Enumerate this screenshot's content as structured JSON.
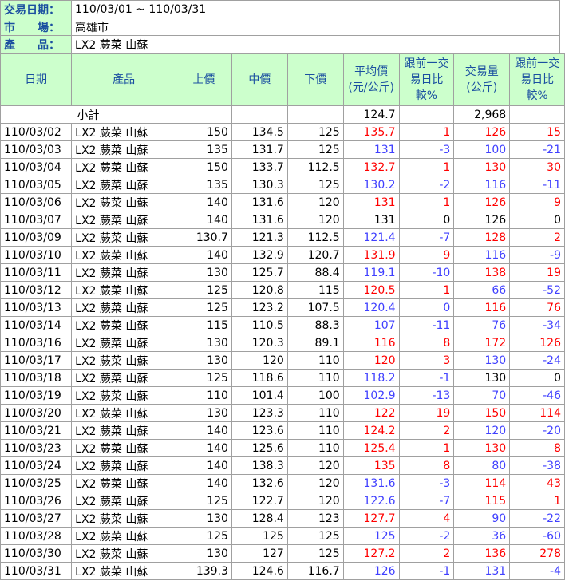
{
  "info": [
    {
      "label": "交易日期：",
      "value": "110/03/01 ~ 110/03/31"
    },
    {
      "label": "市　　場：",
      "value": "高雄市"
    },
    {
      "label": "產　　品：",
      "value": "LX2 蕨菜 山蘇"
    }
  ],
  "headers": [
    "日期",
    "產品",
    "上價",
    "中價",
    "下價",
    "平均價(元/公斤)",
    "跟前一交易日比較%",
    "交易量(公斤)",
    "跟前一交易日比較%"
  ],
  "subtotal": {
    "label": "小計",
    "avg": "124.7",
    "volume": "2,968"
  },
  "colors": {
    "up": "#ff0000",
    "down": "#4040ff",
    "flat": "#000000",
    "header_bg": "#ccffcc",
    "header_text": "#1a4fa0"
  },
  "rows": [
    {
      "date": "110/03/02",
      "product": "LX2 蕨菜 山蘇",
      "high": "150",
      "mid": "134.5",
      "low": "125",
      "avg": "135.7",
      "avg_pct": "1",
      "vol": "126",
      "vol_pct": "15",
      "avg_dir": "up",
      "vol_dir": "up"
    },
    {
      "date": "110/03/03",
      "product": "LX2 蕨菜 山蘇",
      "high": "135",
      "mid": "131.7",
      "low": "125",
      "avg": "131",
      "avg_pct": "-3",
      "vol": "100",
      "vol_pct": "-21",
      "avg_dir": "down",
      "vol_dir": "down"
    },
    {
      "date": "110/03/04",
      "product": "LX2 蕨菜 山蘇",
      "high": "150",
      "mid": "133.7",
      "low": "112.5",
      "avg": "132.7",
      "avg_pct": "1",
      "vol": "130",
      "vol_pct": "30",
      "avg_dir": "up",
      "vol_dir": "up"
    },
    {
      "date": "110/03/05",
      "product": "LX2 蕨菜 山蘇",
      "high": "135",
      "mid": "130.3",
      "low": "125",
      "avg": "130.2",
      "avg_pct": "-2",
      "vol": "116",
      "vol_pct": "-11",
      "avg_dir": "down",
      "vol_dir": "down"
    },
    {
      "date": "110/03/06",
      "product": "LX2 蕨菜 山蘇",
      "high": "140",
      "mid": "131.6",
      "low": "120",
      "avg": "131",
      "avg_pct": "1",
      "vol": "126",
      "vol_pct": "9",
      "avg_dir": "up",
      "vol_dir": "up"
    },
    {
      "date": "110/03/07",
      "product": "LX2 蕨菜 山蘇",
      "high": "140",
      "mid": "131.6",
      "low": "120",
      "avg": "131",
      "avg_pct": "0",
      "vol": "126",
      "vol_pct": "0",
      "avg_dir": "flat",
      "vol_dir": "flat"
    },
    {
      "date": "110/03/09",
      "product": "LX2 蕨菜 山蘇",
      "high": "130.7",
      "mid": "121.3",
      "low": "112.5",
      "avg": "121.4",
      "avg_pct": "-7",
      "vol": "128",
      "vol_pct": "2",
      "avg_dir": "down",
      "vol_dir": "up"
    },
    {
      "date": "110/03/10",
      "product": "LX2 蕨菜 山蘇",
      "high": "140",
      "mid": "132.9",
      "low": "120.7",
      "avg": "131.9",
      "avg_pct": "9",
      "vol": "116",
      "vol_pct": "-9",
      "avg_dir": "up",
      "vol_dir": "down"
    },
    {
      "date": "110/03/11",
      "product": "LX2 蕨菜 山蘇",
      "high": "130",
      "mid": "125.7",
      "low": "88.4",
      "avg": "119.1",
      "avg_pct": "-10",
      "vol": "138",
      "vol_pct": "19",
      "avg_dir": "down",
      "vol_dir": "up"
    },
    {
      "date": "110/03/12",
      "product": "LX2 蕨菜 山蘇",
      "high": "125",
      "mid": "120.8",
      "low": "115",
      "avg": "120.5",
      "avg_pct": "1",
      "vol": "66",
      "vol_pct": "-52",
      "avg_dir": "up",
      "vol_dir": "down"
    },
    {
      "date": "110/03/13",
      "product": "LX2 蕨菜 山蘇",
      "high": "125",
      "mid": "123.2",
      "low": "107.5",
      "avg": "120.4",
      "avg_pct": "0",
      "vol": "116",
      "vol_pct": "76",
      "avg_dir": "down",
      "vol_dir": "up"
    },
    {
      "date": "110/03/14",
      "product": "LX2 蕨菜 山蘇",
      "high": "115",
      "mid": "110.5",
      "low": "88.3",
      "avg": "107",
      "avg_pct": "-11",
      "vol": "76",
      "vol_pct": "-34",
      "avg_dir": "down",
      "vol_dir": "down"
    },
    {
      "date": "110/03/16",
      "product": "LX2 蕨菜 山蘇",
      "high": "130",
      "mid": "120.3",
      "low": "89.1",
      "avg": "116",
      "avg_pct": "8",
      "vol": "172",
      "vol_pct": "126",
      "avg_dir": "up",
      "vol_dir": "up"
    },
    {
      "date": "110/03/17",
      "product": "LX2 蕨菜 山蘇",
      "high": "130",
      "mid": "120",
      "low": "110",
      "avg": "120",
      "avg_pct": "3",
      "vol": "130",
      "vol_pct": "-24",
      "avg_dir": "up",
      "vol_dir": "down"
    },
    {
      "date": "110/03/18",
      "product": "LX2 蕨菜 山蘇",
      "high": "125",
      "mid": "118.6",
      "low": "110",
      "avg": "118.2",
      "avg_pct": "-1",
      "vol": "130",
      "vol_pct": "0",
      "avg_dir": "down",
      "vol_dir": "flat"
    },
    {
      "date": "110/03/19",
      "product": "LX2 蕨菜 山蘇",
      "high": "110",
      "mid": "101.4",
      "low": "100",
      "avg": "102.9",
      "avg_pct": "-13",
      "vol": "70",
      "vol_pct": "-46",
      "avg_dir": "down",
      "vol_dir": "down"
    },
    {
      "date": "110/03/20",
      "product": "LX2 蕨菜 山蘇",
      "high": "130",
      "mid": "123.3",
      "low": "110",
      "avg": "122",
      "avg_pct": "19",
      "vol": "150",
      "vol_pct": "114",
      "avg_dir": "up",
      "vol_dir": "up"
    },
    {
      "date": "110/03/21",
      "product": "LX2 蕨菜 山蘇",
      "high": "140",
      "mid": "123.6",
      "low": "110",
      "avg": "124.2",
      "avg_pct": "2",
      "vol": "120",
      "vol_pct": "-20",
      "avg_dir": "up",
      "vol_dir": "down"
    },
    {
      "date": "110/03/23",
      "product": "LX2 蕨菜 山蘇",
      "high": "140",
      "mid": "125.6",
      "low": "110",
      "avg": "125.4",
      "avg_pct": "1",
      "vol": "130",
      "vol_pct": "8",
      "avg_dir": "up",
      "vol_dir": "up"
    },
    {
      "date": "110/03/24",
      "product": "LX2 蕨菜 山蘇",
      "high": "140",
      "mid": "138.3",
      "low": "120",
      "avg": "135",
      "avg_pct": "8",
      "vol": "80",
      "vol_pct": "-38",
      "avg_dir": "up",
      "vol_dir": "down"
    },
    {
      "date": "110/03/25",
      "product": "LX2 蕨菜 山蘇",
      "high": "140",
      "mid": "132.6",
      "low": "120",
      "avg": "131.6",
      "avg_pct": "-3",
      "vol": "114",
      "vol_pct": "43",
      "avg_dir": "down",
      "vol_dir": "up"
    },
    {
      "date": "110/03/26",
      "product": "LX2 蕨菜 山蘇",
      "high": "125",
      "mid": "122.7",
      "low": "120",
      "avg": "122.6",
      "avg_pct": "-7",
      "vol": "115",
      "vol_pct": "1",
      "avg_dir": "down",
      "vol_dir": "up"
    },
    {
      "date": "110/03/27",
      "product": "LX2 蕨菜 山蘇",
      "high": "130",
      "mid": "128.4",
      "low": "123",
      "avg": "127.7",
      "avg_pct": "4",
      "vol": "90",
      "vol_pct": "-22",
      "avg_dir": "up",
      "vol_dir": "down"
    },
    {
      "date": "110/03/28",
      "product": "LX2 蕨菜 山蘇",
      "high": "125",
      "mid": "125",
      "low": "125",
      "avg": "125",
      "avg_pct": "-2",
      "vol": "36",
      "vol_pct": "-60",
      "avg_dir": "down",
      "vol_dir": "down"
    },
    {
      "date": "110/03/30",
      "product": "LX2 蕨菜 山蘇",
      "high": "130",
      "mid": "127",
      "low": "125",
      "avg": "127.2",
      "avg_pct": "2",
      "vol": "136",
      "vol_pct": "278",
      "avg_dir": "up",
      "vol_dir": "up"
    },
    {
      "date": "110/03/31",
      "product": "LX2 蕨菜 山蘇",
      "high": "139.3",
      "mid": "124.6",
      "low": "116.7",
      "avg": "126",
      "avg_pct": "-1",
      "vol": "131",
      "vol_pct": "-4",
      "avg_dir": "down",
      "vol_dir": "down"
    }
  ]
}
